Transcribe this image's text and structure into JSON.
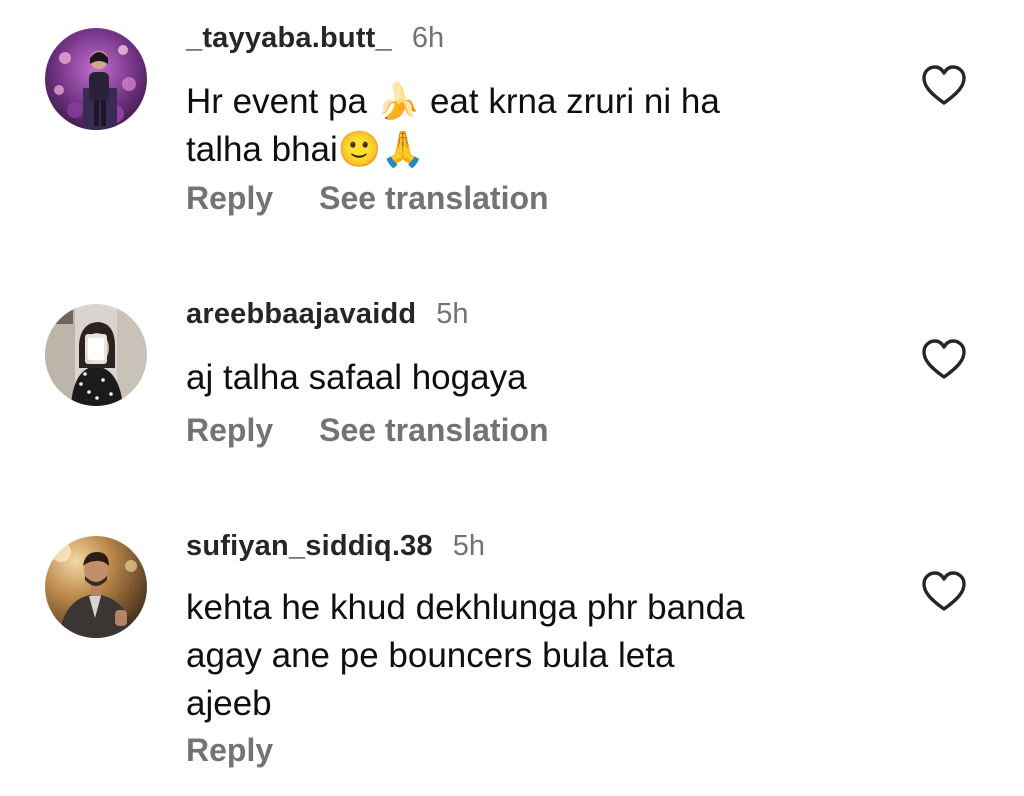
{
  "comments": [
    {
      "username": "_tayyaba.butt_",
      "time": "6h",
      "text": "Hr event pa 🍌 eat krna zruri ni ha\ntalha bhai🙂🙏",
      "reply_label": "Reply",
      "translate_label": "See translation",
      "avatar_icon": "avatar-woman-lights"
    },
    {
      "username": "areebbaajavaidd",
      "time": "5h",
      "text": "aj talha safaal hogaya",
      "reply_label": "Reply",
      "translate_label": "See translation",
      "avatar_icon": "avatar-mirror-selfie"
    },
    {
      "username": "sufiyan_siddiq.38",
      "time": "5h",
      "text": "kehta he khud dekhlunga phr banda\nagay ane pe bouncers bula leta\najeeb",
      "reply_label": "Reply",
      "avatar_icon": "avatar-man-suit"
    }
  ],
  "colors": {
    "username": "#262626",
    "secondary": "#737373",
    "text": "#0f0f0f",
    "background": "#ffffff"
  },
  "icons": {
    "like": "heart-outline-icon"
  }
}
